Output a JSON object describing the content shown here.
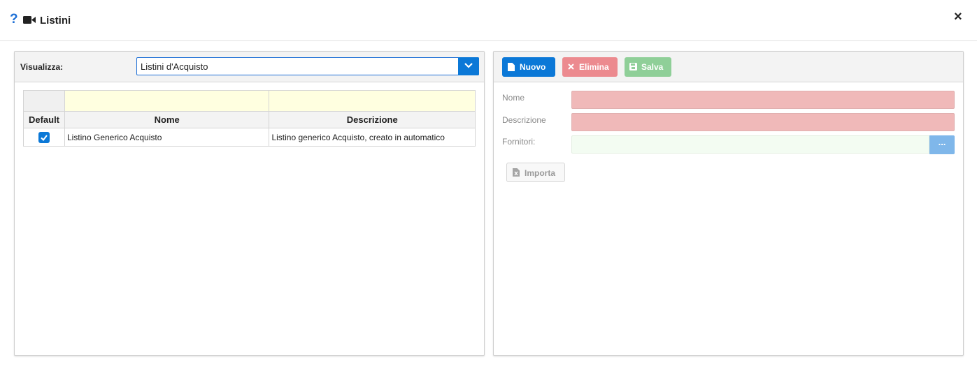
{
  "header": {
    "help_icon": "question-icon",
    "video_icon": "video-camera-icon",
    "title": "Listini",
    "close_label": "×"
  },
  "left_panel": {
    "visualizza_label": "Visualizza:",
    "select_value": "Listini d'Acquisto",
    "grid": {
      "columns": [
        "Default",
        "Nome",
        "Descrizione"
      ],
      "rows": [
        {
          "default": true,
          "nome": "Listino Generico Acquisto",
          "descrizione": "Listino generico Acquisto, creato in automatico"
        }
      ]
    }
  },
  "right_panel": {
    "toolbar": {
      "nuovo_label": "Nuovo",
      "elimina_label": "Elimina",
      "salva_label": "Salva"
    },
    "form": {
      "nome_label": "Nome",
      "descrizione_label": "Descrizione",
      "fornitori_label": "Fornitori:",
      "fornitori_button": "...",
      "importa_label": "Importa"
    }
  },
  "colors": {
    "primary": "#0b78d7",
    "danger": "#ec8a8f",
    "success": "#8fcf98",
    "required_field": "#f0b9b9",
    "filter_row": "#ffffe0"
  }
}
